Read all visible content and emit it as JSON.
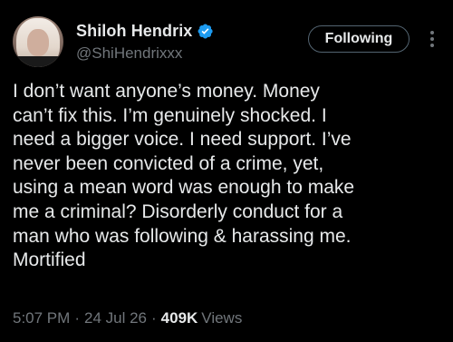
{
  "author": {
    "display_name": "Shiloh Hendrix",
    "handle": "@ShiHendrixxx",
    "verified": true,
    "verified_color": "#1d9bf0"
  },
  "actions": {
    "follow_label": "Following",
    "more_icon": "ellipsis-vertical-icon"
  },
  "tweet": {
    "lines": [
      "I don’t want anyone’s money. Money",
      "can’t fix this. I’m genuinely shocked. I",
      "need a bigger voice. I need support. I’ve",
      "never been convicted of a crime, yet,",
      "using a mean word was enough to make",
      "me a criminal? Disorderly conduct for a",
      "man who was following & harassing me.",
      "Mortified"
    ]
  },
  "meta": {
    "time": "5:07 PM",
    "separator": "·",
    "date": "24 Jul 26",
    "views_count": "409K",
    "views_label": "Views"
  },
  "colors": {
    "background": "#000000",
    "text_primary": "#e7e9ea",
    "text_secondary": "#71767b",
    "button_border": "#536471"
  }
}
